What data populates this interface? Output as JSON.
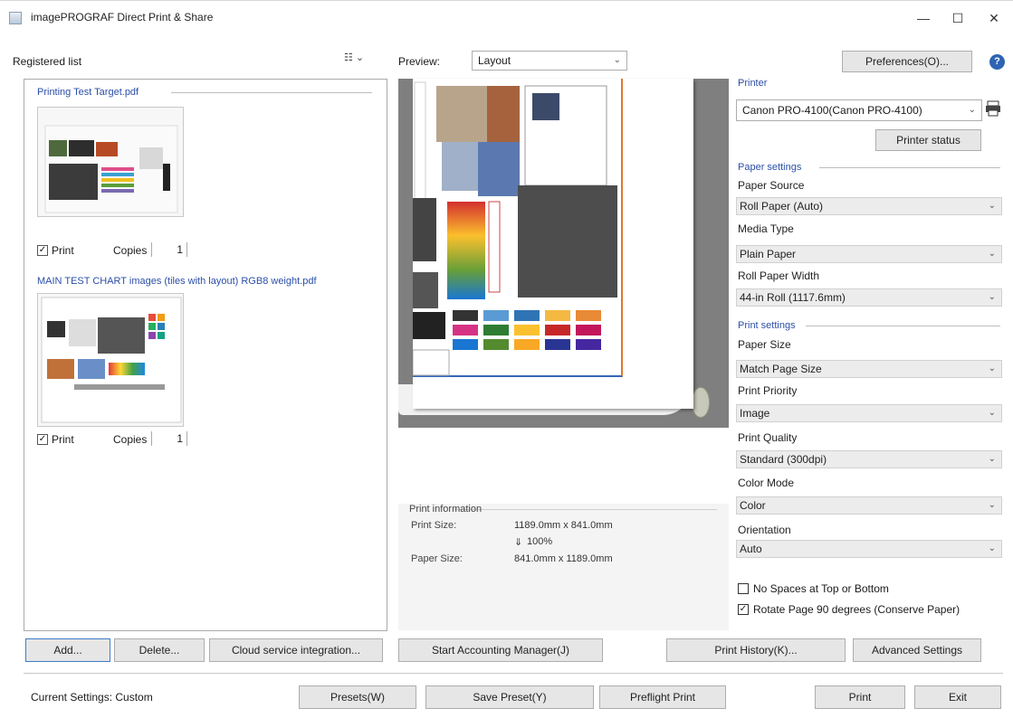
{
  "window": {
    "title": "imagePROGRAF Direct Print & Share",
    "min": "—",
    "max": "☐",
    "close": "✕"
  },
  "left": {
    "registered_label": "Registered list",
    "filter_label": "☷ ⌄",
    "files": [
      {
        "name": "Printing Test Target.pdf",
        "print_label": "Print",
        "copies_label": "Copies",
        "copies": "1",
        "checked": "✓"
      },
      {
        "name": "MAIN TEST CHART images (tiles with layout) RGB8 weight.pdf",
        "print_label": "Print",
        "copies_label": "Copies",
        "copies": "1",
        "checked": "✓"
      }
    ]
  },
  "preview": {
    "label": "Preview:",
    "value": "Layout"
  },
  "print_info": {
    "title": "Print information",
    "print_size_label": "Print Size:",
    "print_size": "1189.0mm x 841.0mm",
    "scale": "100%",
    "scale_icon": "⇓",
    "paper_size_label": "Paper Size:",
    "paper_size": "841.0mm x 1189.0mm"
  },
  "settings": {
    "preferences": "Preferences(O)...",
    "help": "?",
    "printer_title": "Printer",
    "printer": "Canon PRO-4100(Canon PRO-4100)",
    "printer_status": "Printer status",
    "paper_title": "Paper settings",
    "paper_source_label": "Paper Source",
    "paper_source": "Roll Paper (Auto)",
    "media_type_label": "Media Type",
    "media_type": "Plain Paper",
    "roll_width_label": "Roll Paper Width",
    "roll_width": "44-in Roll (1117.6mm)",
    "print_title": "Print settings",
    "paper_size_label": "Paper Size",
    "paper_size": "Match Page Size",
    "print_priority_label": "Print Priority",
    "print_priority": "Image",
    "print_quality_label": "Print Quality",
    "print_quality": "Standard (300dpi)",
    "color_mode_label": "Color Mode",
    "color_mode": "Color",
    "orientation_label": "Orientation",
    "orientation": "Auto",
    "no_spaces_label": "No Spaces at Top or Bottom",
    "rotate_label": "Rotate Page 90 degrees (Conserve Paper)",
    "rotate_checked": "✓"
  },
  "buttons": {
    "add": "Add...",
    "delete": "Delete...",
    "cloud": "Cloud service integration...",
    "accounting": "Start Accounting Manager(J)",
    "history": "Print History(K)...",
    "advanced": "Advanced Settings",
    "presets": "Presets(W)",
    "save_preset": "Save Preset(Y)",
    "preflight": "Preflight Print",
    "print": "Print",
    "exit": "Exit"
  },
  "status": {
    "current_settings": "Current Settings: Custom"
  },
  "colors": {
    "accent": "#2b4fa8",
    "preview_bg": "#7f7f7f",
    "combo_bg": "#ececec"
  }
}
